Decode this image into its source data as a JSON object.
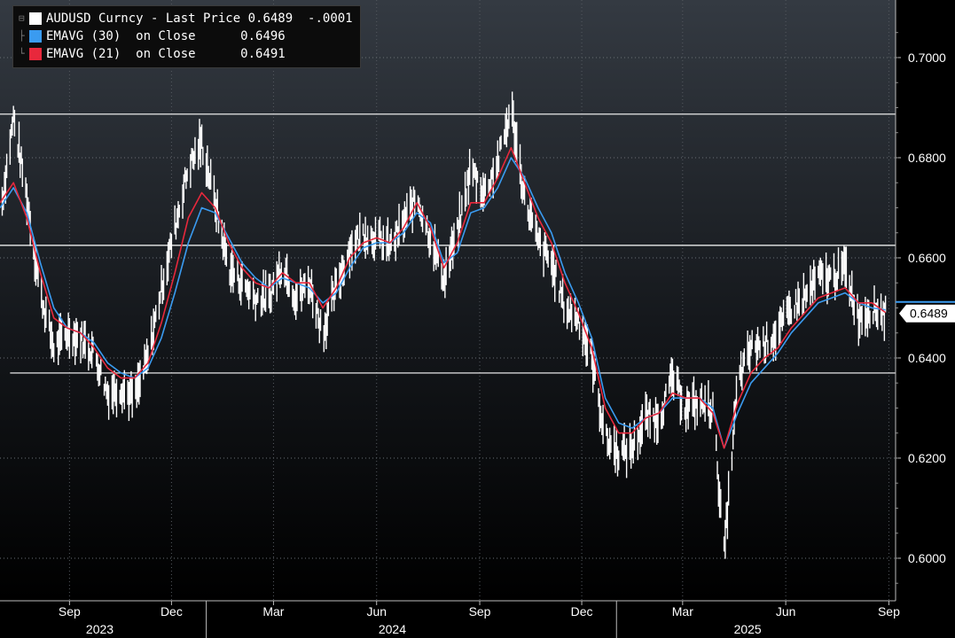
{
  "legend": {
    "price": {
      "label": "AUDUSD Curncy - Last Price",
      "value": "0.6489",
      "change": "-.0001",
      "color": "#ffffff"
    },
    "ema30": {
      "label": "EMAVG (30)  on Close",
      "value": "0.6496",
      "color": "#3a9bf0"
    },
    "ema21": {
      "label": "EMAVG (21)  on Close",
      "value": "0.6491",
      "color": "#e8283c"
    }
  },
  "last_price_tag": "0.6489",
  "chart_data": {
    "type": "line",
    "title": "",
    "xlabel": "",
    "ylabel": "",
    "ylim": [
      0.5915,
      0.7115
    ],
    "xlim": [
      "2023-07-01",
      "2025-09-07"
    ],
    "y_ticks": [
      "0.6000",
      "0.6200",
      "0.6400",
      "0.6600",
      "0.6800",
      "0.7000"
    ],
    "x_month_ticks": [
      {
        "label": "Sep",
        "date": "2023-09-01"
      },
      {
        "label": "Dec",
        "date": "2023-12-01"
      },
      {
        "label": "Mar",
        "date": "2024-03-01"
      },
      {
        "label": "Jun",
        "date": "2024-06-01"
      },
      {
        "label": "Sep",
        "date": "2024-09-01"
      },
      {
        "label": "Dec",
        "date": "2024-12-01"
      },
      {
        "label": "Mar",
        "date": "2025-03-01"
      },
      {
        "label": "Jun",
        "date": "2025-06-01"
      },
      {
        "label": "Sep",
        "date": "2025-09-01"
      }
    ],
    "x_year_labels": [
      {
        "label": "2023",
        "center": "2023-09-28"
      },
      {
        "label": "2024",
        "center": "2024-06-15"
      },
      {
        "label": "2025",
        "center": "2025-04-28"
      }
    ],
    "year_dividers": [
      "2024-01-01",
      "2025-01-01"
    ],
    "horizontal_lines": [
      {
        "y": 0.6887,
        "from": "2023-07-01"
      },
      {
        "y": 0.6625,
        "from": "2023-07-01"
      },
      {
        "y": 0.637,
        "from": "2023-07-10"
      }
    ],
    "grid": "horizontal dotted",
    "legend_position": "top-left",
    "series": [
      {
        "name": "AUDUSD Curncy - Last Price",
        "color": "#ffffff",
        "style": "price bars",
        "points": [
          [
            "2023-07-01",
            0.668
          ],
          [
            "2023-07-13",
            0.688
          ],
          [
            "2023-07-25",
            0.672
          ],
          [
            "2023-08-06",
            0.653
          ],
          [
            "2023-08-18",
            0.642
          ],
          [
            "2023-08-30",
            0.645
          ],
          [
            "2023-09-11",
            0.644
          ],
          [
            "2023-09-23",
            0.641
          ],
          [
            "2023-10-05",
            0.633
          ],
          [
            "2023-10-17",
            0.634
          ],
          [
            "2023-10-29",
            0.632
          ],
          [
            "2023-11-10",
            0.64
          ],
          [
            "2023-11-22",
            0.654
          ],
          [
            "2023-12-04",
            0.666
          ],
          [
            "2023-12-16",
            0.678
          ],
          [
            "2023-12-28",
            0.683
          ],
          [
            "2024-01-09",
            0.671
          ],
          [
            "2024-01-21",
            0.658
          ],
          [
            "2024-02-02",
            0.655
          ],
          [
            "2024-02-14",
            0.652
          ],
          [
            "2024-02-26",
            0.652
          ],
          [
            "2024-03-09",
            0.659
          ],
          [
            "2024-03-21",
            0.652
          ],
          [
            "2024-04-02",
            0.655
          ],
          [
            "2024-04-14",
            0.645
          ],
          [
            "2024-04-26",
            0.654
          ],
          [
            "2024-05-08",
            0.662
          ],
          [
            "2024-05-20",
            0.665
          ],
          [
            "2024-06-01",
            0.664
          ],
          [
            "2024-06-13",
            0.662
          ],
          [
            "2024-06-25",
            0.667
          ],
          [
            "2024-07-07",
            0.672
          ],
          [
            "2024-07-19",
            0.664
          ],
          [
            "2024-07-31",
            0.656
          ],
          [
            "2024-08-12",
            0.665
          ],
          [
            "2024-08-24",
            0.678
          ],
          [
            "2024-09-05",
            0.673
          ],
          [
            "2024-09-17",
            0.679
          ],
          [
            "2024-09-29",
            0.69
          ],
          [
            "2024-10-11",
            0.672
          ],
          [
            "2024-10-23",
            0.663
          ],
          [
            "2024-11-04",
            0.659
          ],
          [
            "2024-11-16",
            0.65
          ],
          [
            "2024-11-28",
            0.648
          ],
          [
            "2024-12-10",
            0.64
          ],
          [
            "2024-12-22",
            0.624
          ],
          [
            "2025-01-03",
            0.621
          ],
          [
            "2025-01-15",
            0.622
          ],
          [
            "2025-01-27",
            0.628
          ],
          [
            "2025-02-08",
            0.628
          ],
          [
            "2025-02-20",
            0.636
          ],
          [
            "2025-03-04",
            0.63
          ],
          [
            "2025-03-16",
            0.631
          ],
          [
            "2025-03-28",
            0.63
          ],
          [
            "2025-04-07",
            0.601
          ],
          [
            "2025-04-19",
            0.635
          ],
          [
            "2025-05-01",
            0.642
          ],
          [
            "2025-05-13",
            0.643
          ],
          [
            "2025-05-25",
            0.645
          ],
          [
            "2025-06-06",
            0.65
          ],
          [
            "2025-06-18",
            0.652
          ],
          [
            "2025-06-30",
            0.656
          ],
          [
            "2025-07-12",
            0.656
          ],
          [
            "2025-07-24",
            0.658
          ],
          [
            "2025-08-05",
            0.648
          ],
          [
            "2025-08-17",
            0.65
          ],
          [
            "2025-08-29",
            0.6489
          ]
        ]
      },
      {
        "name": "EMAVG (30)  on Close",
        "color": "#3a9bf0",
        "points": [
          [
            "2023-07-01",
            0.67
          ],
          [
            "2023-07-13",
            0.674
          ],
          [
            "2023-07-25",
            0.669
          ],
          [
            "2023-08-06",
            0.659
          ],
          [
            "2023-08-18",
            0.65
          ],
          [
            "2023-08-30",
            0.646
          ],
          [
            "2023-09-11",
            0.645
          ],
          [
            "2023-09-23",
            0.643
          ],
          [
            "2023-10-05",
            0.639
          ],
          [
            "2023-10-17",
            0.637
          ],
          [
            "2023-10-29",
            0.636
          ],
          [
            "2023-11-10",
            0.638
          ],
          [
            "2023-11-22",
            0.644
          ],
          [
            "2023-12-04",
            0.653
          ],
          [
            "2023-12-16",
            0.663
          ],
          [
            "2023-12-28",
            0.67
          ],
          [
            "2024-01-09",
            0.669
          ],
          [
            "2024-01-21",
            0.664
          ],
          [
            "2024-02-02",
            0.659
          ],
          [
            "2024-02-14",
            0.656
          ],
          [
            "2024-02-26",
            0.654
          ],
          [
            "2024-03-09",
            0.656
          ],
          [
            "2024-03-21",
            0.655
          ],
          [
            "2024-04-02",
            0.654
          ],
          [
            "2024-04-14",
            0.651
          ],
          [
            "2024-04-26",
            0.653
          ],
          [
            "2024-05-08",
            0.658
          ],
          [
            "2024-05-20",
            0.662
          ],
          [
            "2024-06-01",
            0.663
          ],
          [
            "2024-06-13",
            0.663
          ],
          [
            "2024-06-25",
            0.665
          ],
          [
            "2024-07-07",
            0.669
          ],
          [
            "2024-07-19",
            0.667
          ],
          [
            "2024-07-31",
            0.659
          ],
          [
            "2024-08-12",
            0.661
          ],
          [
            "2024-08-24",
            0.669
          ],
          [
            "2024-09-05",
            0.67
          ],
          [
            "2024-09-17",
            0.674
          ],
          [
            "2024-09-29",
            0.68
          ],
          [
            "2024-10-11",
            0.676
          ],
          [
            "2024-10-23",
            0.67
          ],
          [
            "2024-11-04",
            0.665
          ],
          [
            "2024-11-16",
            0.657
          ],
          [
            "2024-11-28",
            0.651
          ],
          [
            "2024-12-10",
            0.644
          ],
          [
            "2024-12-22",
            0.632
          ],
          [
            "2025-01-03",
            0.627
          ],
          [
            "2025-01-15",
            0.626
          ],
          [
            "2025-01-27",
            0.628
          ],
          [
            "2025-02-08",
            0.629
          ],
          [
            "2025-02-20",
            0.632
          ],
          [
            "2025-03-04",
            0.632
          ],
          [
            "2025-03-16",
            0.632
          ],
          [
            "2025-03-28",
            0.63
          ],
          [
            "2025-04-07",
            0.622
          ],
          [
            "2025-04-19",
            0.629
          ],
          [
            "2025-05-01",
            0.635
          ],
          [
            "2025-05-13",
            0.638
          ],
          [
            "2025-05-25",
            0.641
          ],
          [
            "2025-06-06",
            0.645
          ],
          [
            "2025-06-18",
            0.648
          ],
          [
            "2025-06-30",
            0.651
          ],
          [
            "2025-07-12",
            0.652
          ],
          [
            "2025-07-24",
            0.653
          ],
          [
            "2025-08-05",
            0.651
          ],
          [
            "2025-08-17",
            0.65
          ],
          [
            "2025-08-29",
            0.6496
          ]
        ]
      },
      {
        "name": "EMAVG (21)  on Close",
        "color": "#e8283c",
        "points": [
          [
            "2023-07-01",
            0.671
          ],
          [
            "2023-07-13",
            0.675
          ],
          [
            "2023-07-25",
            0.668
          ],
          [
            "2023-08-06",
            0.657
          ],
          [
            "2023-08-18",
            0.648
          ],
          [
            "2023-08-30",
            0.646
          ],
          [
            "2023-09-11",
            0.645
          ],
          [
            "2023-09-23",
            0.642
          ],
          [
            "2023-10-05",
            0.638
          ],
          [
            "2023-10-17",
            0.636
          ],
          [
            "2023-10-29",
            0.636
          ],
          [
            "2023-11-10",
            0.639
          ],
          [
            "2023-11-22",
            0.647
          ],
          [
            "2023-12-04",
            0.657
          ],
          [
            "2023-12-16",
            0.668
          ],
          [
            "2023-12-28",
            0.673
          ],
          [
            "2024-01-09",
            0.67
          ],
          [
            "2024-01-21",
            0.663
          ],
          [
            "2024-02-02",
            0.658
          ],
          [
            "2024-02-14",
            0.655
          ],
          [
            "2024-02-26",
            0.654
          ],
          [
            "2024-03-09",
            0.657
          ],
          [
            "2024-03-21",
            0.655
          ],
          [
            "2024-04-02",
            0.655
          ],
          [
            "2024-04-14",
            0.65
          ],
          [
            "2024-04-26",
            0.654
          ],
          [
            "2024-05-08",
            0.66
          ],
          [
            "2024-05-20",
            0.663
          ],
          [
            "2024-06-01",
            0.664
          ],
          [
            "2024-06-13",
            0.663
          ],
          [
            "2024-06-25",
            0.666
          ],
          [
            "2024-07-07",
            0.671
          ],
          [
            "2024-07-19",
            0.666
          ],
          [
            "2024-07-31",
            0.658
          ],
          [
            "2024-08-12",
            0.663
          ],
          [
            "2024-08-24",
            0.671
          ],
          [
            "2024-09-05",
            0.671
          ],
          [
            "2024-09-17",
            0.676
          ],
          [
            "2024-09-29",
            0.682
          ],
          [
            "2024-10-11",
            0.675
          ],
          [
            "2024-10-23",
            0.668
          ],
          [
            "2024-11-04",
            0.663
          ],
          [
            "2024-11-16",
            0.655
          ],
          [
            "2024-11-28",
            0.649
          ],
          [
            "2024-12-10",
            0.642
          ],
          [
            "2024-12-22",
            0.63
          ],
          [
            "2025-01-03",
            0.625
          ],
          [
            "2025-01-15",
            0.625
          ],
          [
            "2025-01-27",
            0.628
          ],
          [
            "2025-02-08",
            0.629
          ],
          [
            "2025-02-20",
            0.633
          ],
          [
            "2025-03-04",
            0.632
          ],
          [
            "2025-03-16",
            0.632
          ],
          [
            "2025-03-28",
            0.629
          ],
          [
            "2025-04-07",
            0.622
          ],
          [
            "2025-04-19",
            0.631
          ],
          [
            "2025-05-01",
            0.637
          ],
          [
            "2025-05-13",
            0.64
          ],
          [
            "2025-05-25",
            0.642
          ],
          [
            "2025-06-06",
            0.646
          ],
          [
            "2025-06-18",
            0.649
          ],
          [
            "2025-06-30",
            0.652
          ],
          [
            "2025-07-12",
            0.653
          ],
          [
            "2025-07-24",
            0.654
          ],
          [
            "2025-08-05",
            0.651
          ],
          [
            "2025-08-17",
            0.651
          ],
          [
            "2025-08-29",
            0.6491
          ]
        ]
      }
    ]
  }
}
